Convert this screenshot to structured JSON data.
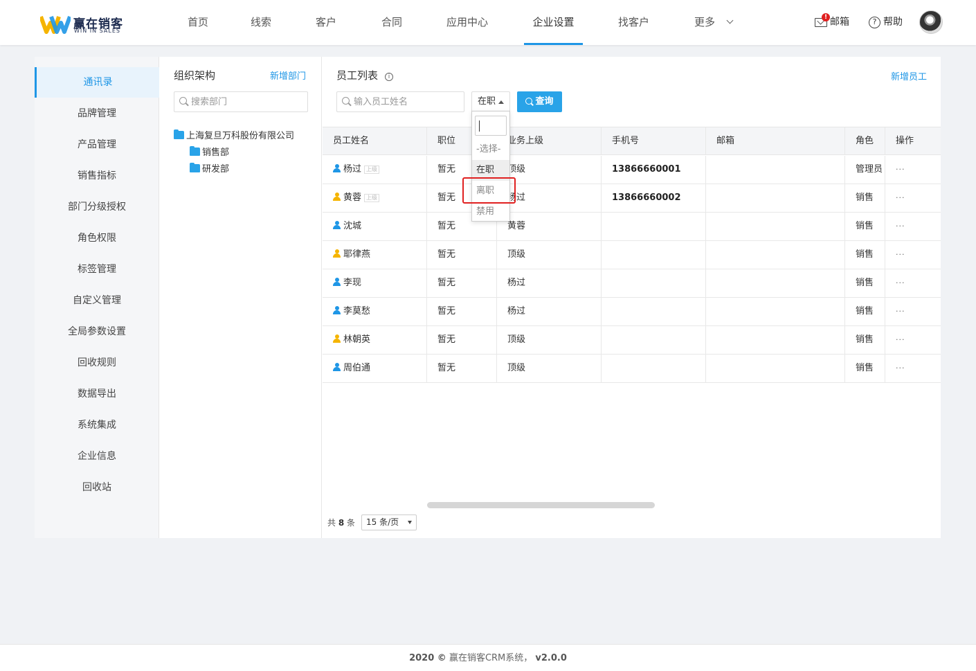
{
  "app": {
    "logo_cn": "赢在销客",
    "logo_en": "WIN IN SALES",
    "colors": {
      "accent": "#1e96e6",
      "brand_yellow": "#f5b400",
      "brand_blue": "#1e96e6",
      "badge": "#e02020"
    }
  },
  "nav": {
    "items": [
      {
        "label": "首页"
      },
      {
        "label": "线索"
      },
      {
        "label": "客户"
      },
      {
        "label": "合同"
      },
      {
        "label": "应用中心"
      },
      {
        "label": "企业设置",
        "active": true
      },
      {
        "label": "找客户"
      },
      {
        "label": "更多"
      }
    ],
    "mail_label": "邮箱",
    "mail_badge": "!",
    "help_label": "帮助"
  },
  "sidebar": {
    "items": [
      {
        "label": "通讯录",
        "active": true
      },
      {
        "label": "品牌管理"
      },
      {
        "label": "产品管理"
      },
      {
        "label": "销售指标"
      },
      {
        "label": "部门分级授权"
      },
      {
        "label": "角色权限"
      },
      {
        "label": "标签管理"
      },
      {
        "label": "自定义管理"
      },
      {
        "label": "全局参数设置"
      },
      {
        "label": "回收规则"
      },
      {
        "label": "数据导出"
      },
      {
        "label": "系统集成"
      },
      {
        "label": "企业信息"
      },
      {
        "label": "回收站"
      }
    ]
  },
  "org": {
    "title": "组织架构",
    "add_label": "新增部门",
    "search_placeholder": "搜索部门",
    "tree": {
      "root": "上海复旦万科股份有限公司",
      "children": [
        "销售部",
        "研发部"
      ]
    }
  },
  "employees": {
    "title": "员工列表",
    "info_icon": "i",
    "add_label": "新增员工",
    "search_placeholder": "输入员工姓名",
    "status_value": "在职",
    "query_label": "查询",
    "columns": [
      "员工姓名",
      "职位",
      "业务上级",
      "手机号",
      "邮箱",
      "角色",
      "操作"
    ],
    "superior_tag": "上级",
    "ops_label": "···",
    "rows": [
      {
        "name": "杨过",
        "tag": true,
        "icon_color": "#1e96e6",
        "position": "暂无",
        "superior": "顶级",
        "phone": "13866660001",
        "email": "",
        "role": "管理员"
      },
      {
        "name": "黄蓉",
        "tag": true,
        "icon_color": "#f5b400",
        "position": "暂无",
        "superior": "杨过",
        "phone": "13866660002",
        "email": "",
        "role": "销售"
      },
      {
        "name": "沈城",
        "tag": false,
        "icon_color": "#1e96e6",
        "position": "暂无",
        "superior": "黄蓉",
        "phone": "",
        "email": "",
        "role": "销售"
      },
      {
        "name": "耶律燕",
        "tag": false,
        "icon_color": "#f5b400",
        "position": "暂无",
        "superior": "顶级",
        "phone": "",
        "email": "",
        "role": "销售"
      },
      {
        "name": "李现",
        "tag": false,
        "icon_color": "#1e96e6",
        "position": "暂无",
        "superior": "杨过",
        "phone": "",
        "email": "",
        "role": "销售"
      },
      {
        "name": "李莫愁",
        "tag": false,
        "icon_color": "#1e96e6",
        "position": "暂无",
        "superior": "杨过",
        "phone": "",
        "email": "",
        "role": "销售"
      },
      {
        "name": "林朝英",
        "tag": false,
        "icon_color": "#f5b400",
        "position": "暂无",
        "superior": "顶级",
        "phone": "",
        "email": "",
        "role": "销售"
      },
      {
        "name": "周伯通",
        "tag": false,
        "icon_color": "#1e96e6",
        "position": "暂无",
        "superior": "顶级",
        "phone": "",
        "email": "",
        "role": "销售"
      }
    ],
    "pager": {
      "total_prefix": "共",
      "total": "8",
      "total_suffix": "条",
      "page_size": "15 条/页"
    }
  },
  "status_dropdown": {
    "options": [
      {
        "label": "-选择-"
      },
      {
        "label": "在职",
        "selected": true
      },
      {
        "label": "离职",
        "highlighted": true
      },
      {
        "label": "禁用"
      }
    ]
  },
  "footer": {
    "year": "2020 ©",
    "text": "赢在销客CRM系统，",
    "version": "v2.0.0"
  }
}
